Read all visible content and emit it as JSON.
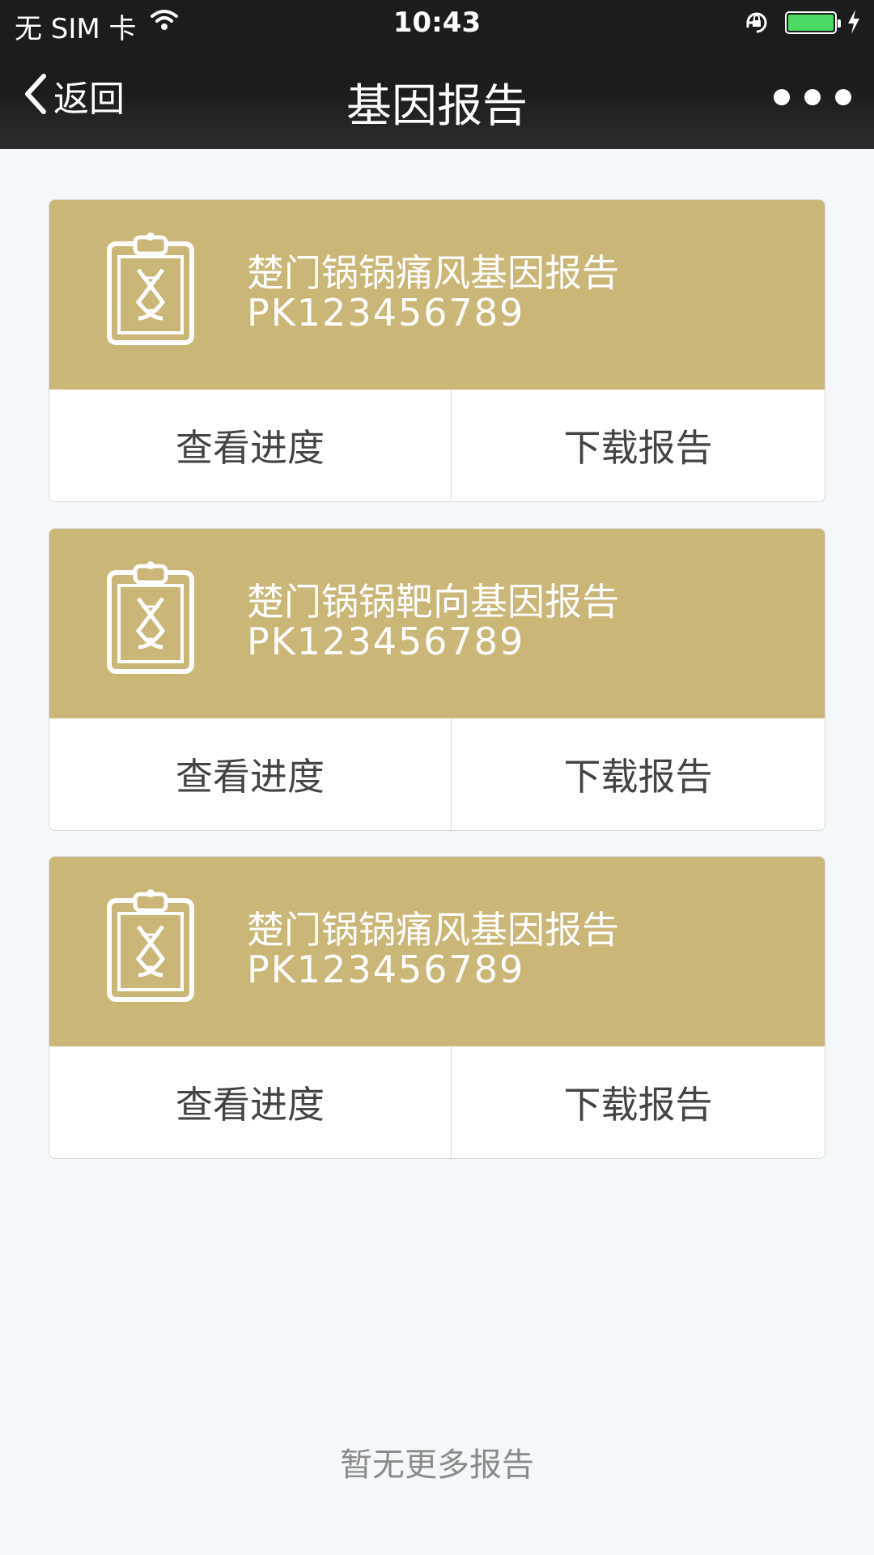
{
  "status_bar": {
    "carrier": "无 SIM 卡",
    "time": "10:43"
  },
  "nav": {
    "back_label": "返回",
    "title": "基因报告"
  },
  "reports": [
    {
      "name": "楚门锅锅痛风基因报告",
      "code": "PK123456789",
      "progress_label": "查看进度",
      "download_label": "下载报告"
    },
    {
      "name": "楚门锅锅靶向基因报告",
      "code": "PK123456789",
      "progress_label": "查看进度",
      "download_label": "下载报告"
    },
    {
      "name": "楚门锅锅痛风基因报告",
      "code": "PK123456789",
      "progress_label": "查看进度",
      "download_label": "下载报告"
    }
  ],
  "footer": {
    "text": "暂无更多报告"
  },
  "colors": {
    "card_header": "#cab676",
    "nav_bg": "#1c1c1e",
    "page_bg": "#f5f8fa",
    "battery": "#4cd964"
  }
}
